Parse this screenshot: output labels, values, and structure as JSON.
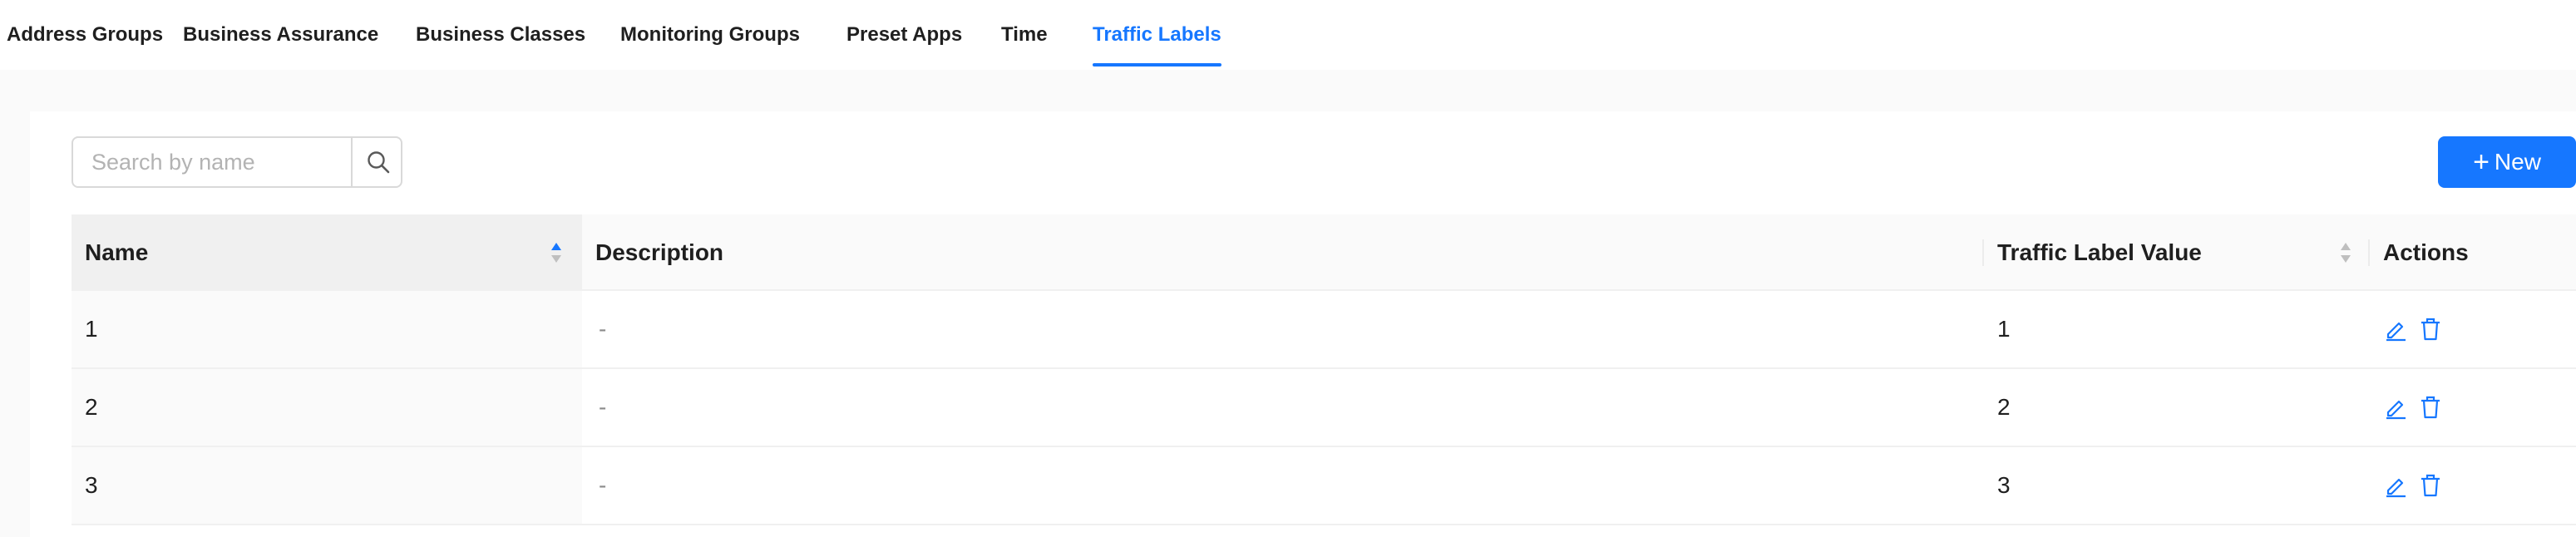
{
  "tabs": [
    {
      "label": "Address Groups",
      "active": false
    },
    {
      "label": "Business Assurance",
      "active": false
    },
    {
      "label": "Business Classes",
      "active": false
    },
    {
      "label": "Monitoring Groups",
      "active": false
    },
    {
      "label": "Preset Apps",
      "active": false
    },
    {
      "label": "Time",
      "active": false
    },
    {
      "label": "Traffic Labels",
      "active": true
    }
  ],
  "toolbar": {
    "search_placeholder": "Search by name",
    "search_value": "",
    "search_icon": "search-icon",
    "new_label": "New",
    "new_icon": "plus-icon"
  },
  "table": {
    "columns": [
      "Name",
      "Description",
      "Traffic Label Value",
      "Actions"
    ],
    "sort_column": "Name",
    "rows": [
      {
        "name": "1",
        "description": "-",
        "value": "1",
        "actions": [
          "edit-icon",
          "delete-icon"
        ]
      },
      {
        "name": "2",
        "description": "-",
        "value": "2",
        "actions": [
          "edit-icon",
          "delete-icon"
        ]
      },
      {
        "name": "3",
        "description": "-",
        "value": "3",
        "actions": [
          "edit-icon",
          "delete-icon"
        ]
      }
    ]
  },
  "colors": {
    "accent": "#1677ff",
    "sorter_inactive": "#bfbfbf",
    "header_bg": "#fafafa",
    "sorted_col_bg": "#f0f0f0",
    "border": "#f0f0f0"
  }
}
